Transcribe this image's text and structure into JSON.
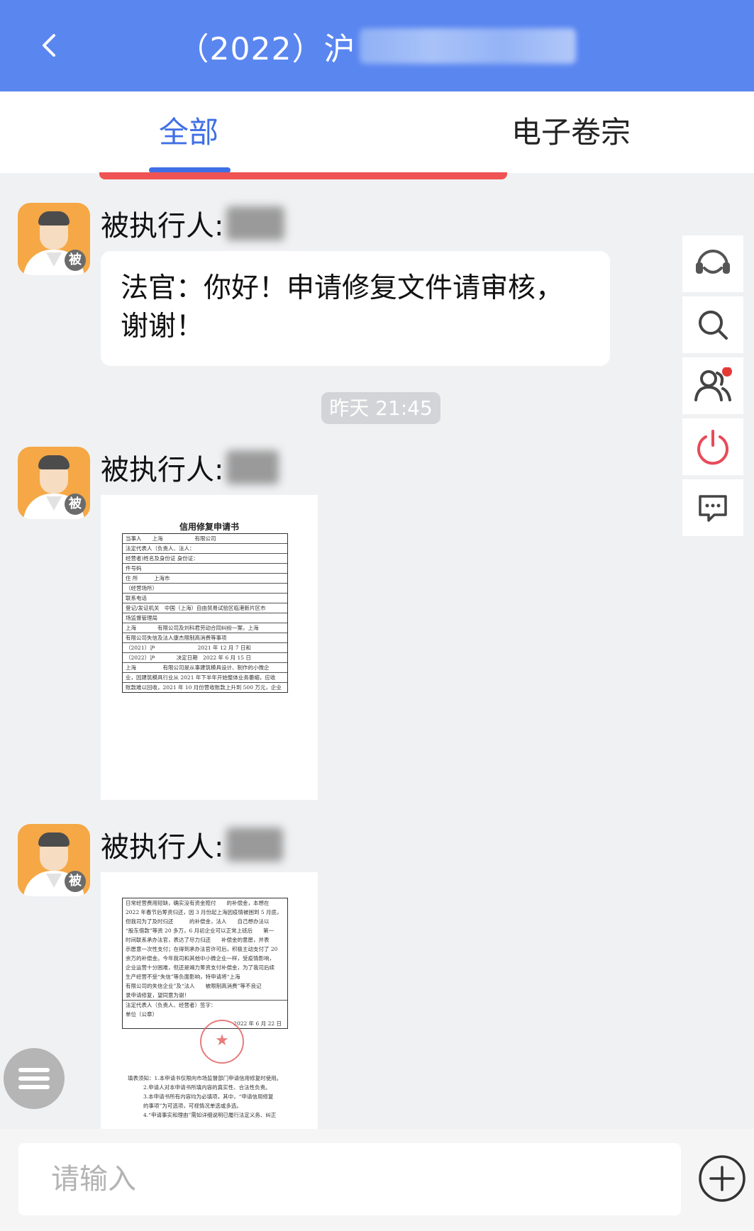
{
  "header": {
    "title": "（2022）沪"
  },
  "tabs": [
    {
      "label": "全部",
      "active": true
    },
    {
      "label": "电子卷宗",
      "active": false
    }
  ],
  "messages": [
    {
      "sender_label": "被执行人:",
      "text": "法官：你好！申请修复文件请审核，谢谢！"
    },
    {
      "sender_label": "被执行人:"
    },
    {
      "sender_label": "被执行人:"
    }
  ],
  "timestamp": "昨天 21:45",
  "avatar_badge": "被",
  "doc1": {
    "title": "信用修复申请书",
    "rows": [
      "当事人　　上海　　　　　　有限公司",
      "法定代表人（负责人、法人：　　",
      "经营者)姓名及身份证 身份证：",
      "件号码",
      "住 所　　　上海市",
      "（经营场所）",
      "联系电话",
      "登记/发证机关　中国（上海）自由贸易试验区临港新片区市",
      "场监督管理局",
      "上海　　　　有限公司及刘科君劳动合同纠纷一案，上海",
      "有限公司失信及法人康杰限制高消费等事项",
      "（2021）沪　　　　　　　　2021 年 12 月 7 日和",
      "（2022）沪　　　　决定日期　2022 年 6 月 15 日",
      "上海　　　　　有限公司是从事建筑模具设计、制作的小微企",
      "业，因建筑模具行业从 2021 年下半年开始整体业务萎缩，应收",
      "账款难以回收，2021 年 10 月份营收账款上升到 500 万元，企业"
    ]
  },
  "doc2": {
    "rows": [
      "日常经营费用短缺，确实没有资金赔付　　的补偿金，本想在",
      "2022 年春节后筹资归还，因 3 月份起上海因疫情被困到 5 月底，",
      "但我司为了及时归还　　　的补偿金，法人　　自己想办法以",
      "“股东借款”等资 20 多万，6 月初企业可以正常上班后　　第一",
      "时间联系承办法官，表达了尽力归还　　补偿金的意愿，并表",
      "示愿意一次性支付；在得到承办法官许可后，积极主动支付了 20",
      "余万的补偿金。今年我司和其他中小微企业一样，受疫情影响，",
      "企业运营十分困难，但还是竭力筹资支付补偿金，为了我司后续",
      "生产经营不受“失信”等负面影响，特申请将“上海",
      "有限公司的失信企业”及“法人　　被限制高消费”等不良记",
      "录申请修复，望同意为谢！",
      "法定代表人（负责人、经营者）签字：",
      "单位（公章）",
      "2022 年 6 月 22 日",
      "填表须知：1.本申请书仅限向市场监督部门申请信用修复时使用。",
      "2.申请人对本申请书所填内容的真实性、合法性负责。",
      "3.本申请书所有内容均为必填项，其中，“申请信用修复",
      "的事项”为可选项，可视情况单选或多选。",
      "4.“申请事实和理由”需如详细说明已履行法定义务、纠正"
    ]
  },
  "input": {
    "placeholder": "请输入",
    "value": ""
  },
  "colors": {
    "header": "#5a86f0",
    "tab_active": "#3f6fe6",
    "red_accent": "#ef5353",
    "avatar_bg": "#f5a845"
  },
  "side_icons": [
    "customer-service-icon",
    "search-icon",
    "users-icon",
    "power-icon",
    "message-icon"
  ]
}
